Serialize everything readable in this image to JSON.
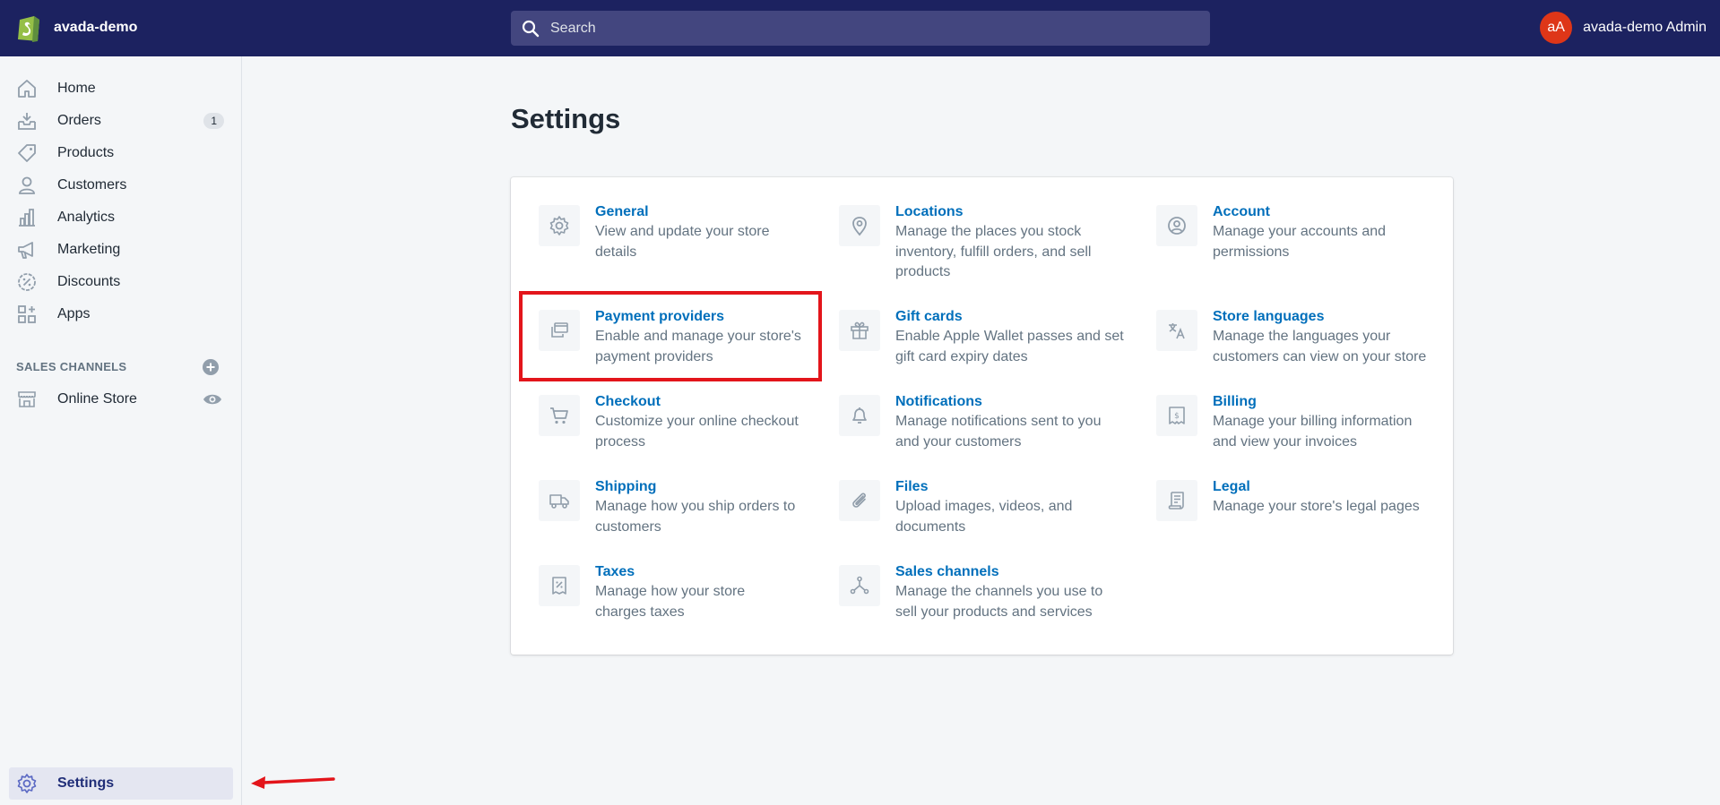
{
  "topbar": {
    "store_name": "avada-demo",
    "search_placeholder": "Search",
    "avatar_initials": "aA",
    "user_name": "avada-demo Admin"
  },
  "sidebar": {
    "items": [
      {
        "label": "Home",
        "icon": "home-icon"
      },
      {
        "label": "Orders",
        "icon": "orders-icon",
        "badge": "1"
      },
      {
        "label": "Products",
        "icon": "tag-icon"
      },
      {
        "label": "Customers",
        "icon": "person-icon"
      },
      {
        "label": "Analytics",
        "icon": "bar-chart-icon"
      },
      {
        "label": "Marketing",
        "icon": "megaphone-icon"
      },
      {
        "label": "Discounts",
        "icon": "discount-icon"
      },
      {
        "label": "Apps",
        "icon": "apps-icon"
      }
    ],
    "sales_channels_title": "SALES CHANNELS",
    "online_store_label": "Online Store",
    "settings_label": "Settings"
  },
  "main": {
    "title": "Settings",
    "settings": [
      {
        "title": "General",
        "desc": "View and update your store details",
        "icon": "gear-icon"
      },
      {
        "title": "Locations",
        "desc": "Manage the places you stock inventory, fulfill orders, and sell products",
        "icon": "location-pin-icon"
      },
      {
        "title": "Account",
        "desc": "Manage your accounts and permissions",
        "icon": "account-icon"
      },
      {
        "title": "Payment providers",
        "desc": "Enable and manage your store's payment providers",
        "icon": "payment-icon"
      },
      {
        "title": "Gift cards",
        "desc": "Enable Apple Wallet passes and set gift card expiry dates",
        "icon": "gift-icon"
      },
      {
        "title": "Store languages",
        "desc": "Manage the languages your customers can view on your store",
        "icon": "translate-icon"
      },
      {
        "title": "Checkout",
        "desc": "Customize your online checkout process",
        "icon": "cart-icon"
      },
      {
        "title": "Notifications",
        "desc": "Manage notifications sent to you and your customers",
        "icon": "bell-icon"
      },
      {
        "title": "Billing",
        "desc": "Manage your billing information and view your invoices",
        "icon": "billing-icon"
      },
      {
        "title": "Shipping",
        "desc": "Manage how you ship orders to customers",
        "icon": "truck-icon"
      },
      {
        "title": "Files",
        "desc": "Upload images, videos, and documents",
        "icon": "paperclip-icon"
      },
      {
        "title": "Legal",
        "desc": "Manage your store's legal pages",
        "icon": "legal-icon"
      },
      {
        "title": "Taxes",
        "desc": "Manage how your store charges taxes",
        "icon": "tax-icon"
      },
      {
        "title": "Sales channels",
        "desc": "Manage the channels you use to sell your products and services",
        "icon": "sales-channels-icon"
      }
    ]
  },
  "colors": {
    "topbar": "#1c2260",
    "link": "#006fbb",
    "highlight": "#e3151b",
    "avatar": "#de3618"
  }
}
